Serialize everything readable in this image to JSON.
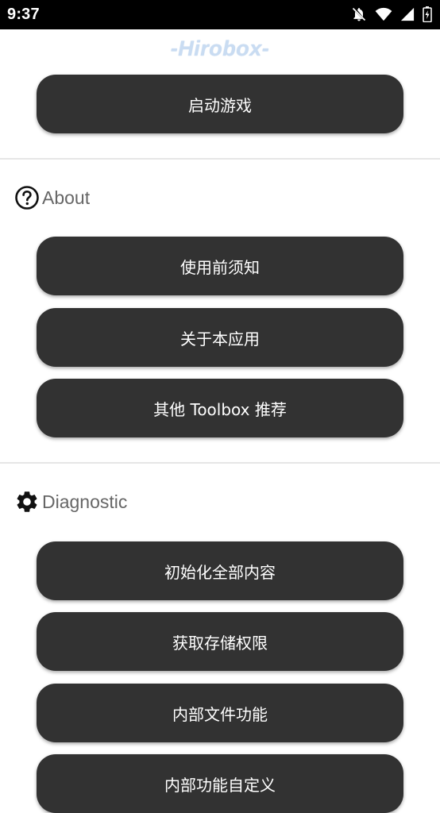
{
  "status_bar": {
    "time": "9:37",
    "icons": [
      "notifications-off-icon",
      "wifi-icon",
      "signal-icon",
      "battery-icon"
    ]
  },
  "app": {
    "logo_text": "-Hirobox-"
  },
  "main": {
    "launch_button": "启动游戏"
  },
  "sections": {
    "about": {
      "title": "About",
      "icon": "help-circle-icon",
      "buttons": [
        "使用前须知",
        "关于本应用",
        "其他 Toolbox 推荐"
      ]
    },
    "diagnostic": {
      "title": "Diagnostic",
      "icon": "gear-icon",
      "buttons": [
        "初始化全部内容",
        "获取存储权限",
        "内部文件功能",
        "内部功能自定义"
      ]
    }
  },
  "colors": {
    "button_bg": "#323232",
    "button_text": "#ffffff",
    "section_title": "#666666",
    "logo": "#c9dcf2",
    "status_bar_bg": "#000000"
  }
}
